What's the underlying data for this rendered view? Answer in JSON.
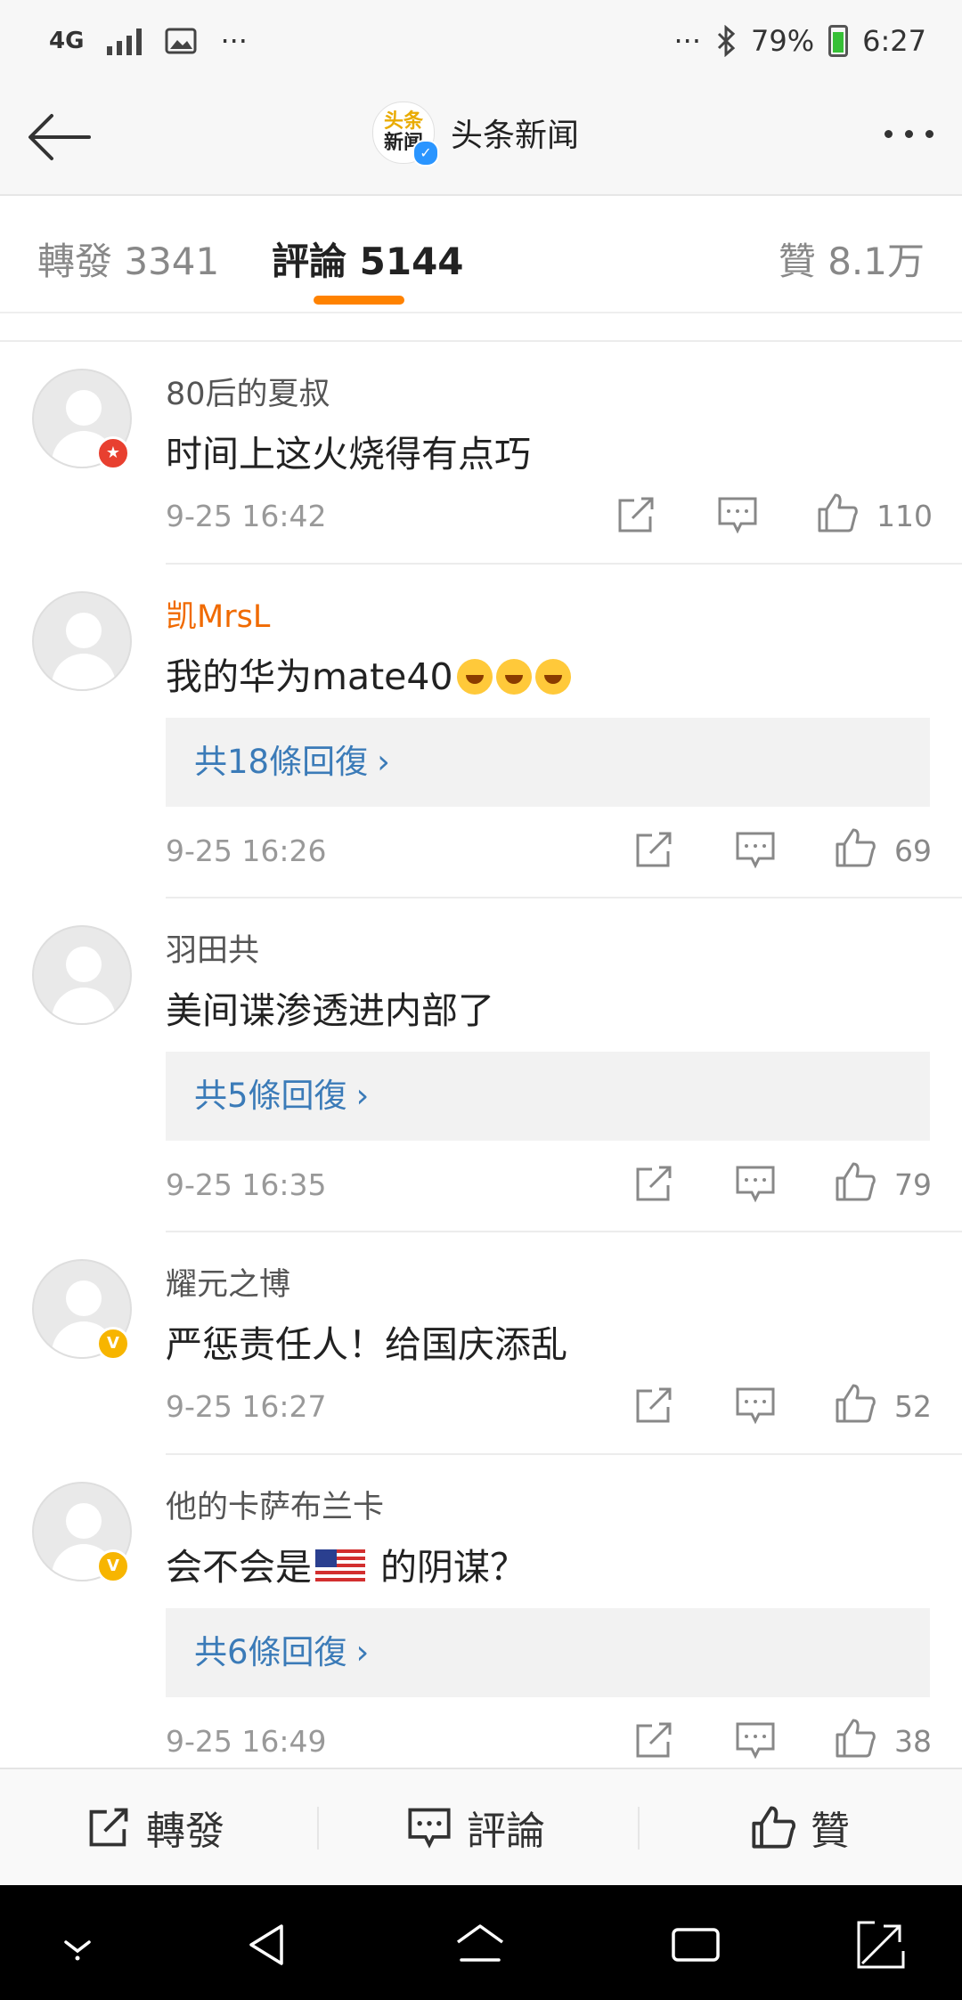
{
  "status_bar": {
    "network": "4G",
    "battery": "79%",
    "time": "6:27",
    "icons": [
      "network-4g-icon",
      "signal-icon",
      "image-icon",
      "more-dots-icon",
      "bluetooth-icon",
      "battery-icon"
    ]
  },
  "header": {
    "logo_line1": "头条",
    "logo_line2": "新闻",
    "title": "头条新闻"
  },
  "tabs": {
    "repost": "轉發 3341",
    "comments": "評論 5144",
    "likes": "贊 8.1万"
  },
  "comments": [
    {
      "user": "80后的夏叔",
      "text": "时间上这火烧得有点巧",
      "time": "9-25 16:42",
      "likes": "110",
      "badge": "red"
    },
    {
      "user": "凯MrsL",
      "text": "我的华为mate40",
      "replies": "共18條回復",
      "time": "9-25 16:26",
      "likes": "69",
      "username_color": "#f06a00"
    },
    {
      "user": "羽田共",
      "text": "美间谍渗透进内部了",
      "replies": "共5條回復",
      "time": "9-25 16:35",
      "likes": "79"
    },
    {
      "user": "耀元之博",
      "text": "严惩责任人！给国庆添乱",
      "time": "9-25 16:27",
      "likes": "52",
      "badge": "gold"
    },
    {
      "user": "他的卡萨布兰卡",
      "text_before": "会不会是",
      "text_after": " 的阴谋？",
      "replies": "共6條回復",
      "time": "9-25 16:49",
      "likes": "38",
      "badge": "gold"
    }
  ],
  "reply_chevron": "›",
  "bottom_bar": {
    "repost": "轉發",
    "comment": "評論",
    "like": "贊"
  },
  "colors": {
    "accent": "#ff8200",
    "link": "#3b7bb8",
    "vip_gold": "#f7b500",
    "vip_red": "#e84030"
  }
}
